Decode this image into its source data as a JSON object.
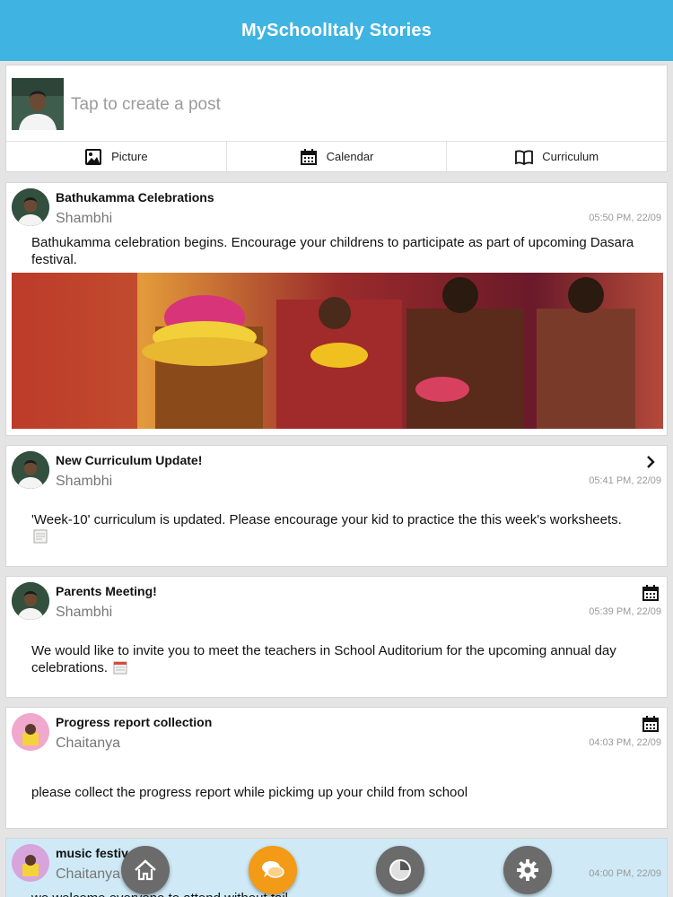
{
  "header": {
    "title": "MySchoolItaly Stories"
  },
  "composer": {
    "placeholder": "Tap to create a post",
    "actions": [
      {
        "label": "Picture",
        "icon": "picture-icon"
      },
      {
        "label": "Calendar",
        "icon": "calendar-icon"
      },
      {
        "label": "Curriculum",
        "icon": "book-icon"
      }
    ]
  },
  "posts": [
    {
      "title": "Bathukamma Celebrations",
      "author": "Shambhi",
      "time": "05:50 PM, 22/09",
      "body": "Bathukamma celebration begins. Encourage your childrens to participate as part of upcoming Dasara festival.",
      "has_photo": true
    },
    {
      "title": "New Curriculum Update!",
      "author": "Shambhi",
      "time": "05:41 PM, 22/09",
      "body": "'Week-10' curriculum is updated. Please encourage your kid to practice the this week's worksheets.",
      "corner_icon": "chevron-right-icon",
      "inline_icon": "note-icon"
    },
    {
      "title": "Parents Meeting!",
      "author": "Shambhi",
      "time": "05:39 PM, 22/09",
      "body": "We would like to invite you to meet the teachers in School Auditorium for the upcoming annual day celebrations.",
      "corner_icon": "calendar-icon",
      "inline_icon": "calendar-mini-icon"
    },
    {
      "title": "Progress report collection",
      "author": "Chaitanya",
      "time": "04:03 PM, 22/09",
      "body": "please collect the progress report while pickimg up your child from school",
      "corner_icon": "calendar-icon"
    },
    {
      "title": "music festiv",
      "author": "Chaitanya",
      "time": "04:00 PM, 22/09",
      "body": "we welcome everyone to attend without fail"
    }
  ],
  "tabs": [
    {
      "name": "home",
      "icon": "home-icon"
    },
    {
      "name": "messages",
      "icon": "chat-bubbles-icon"
    },
    {
      "name": "history",
      "icon": "clock-icon"
    },
    {
      "name": "settings",
      "icon": "gear-icon"
    }
  ],
  "colors": {
    "header_bg": "#3fb4e2",
    "highlight_card_bg": "#cfeaf6",
    "chat_tab": "#f39a16",
    "gray_tab": "#6b6b6b"
  }
}
